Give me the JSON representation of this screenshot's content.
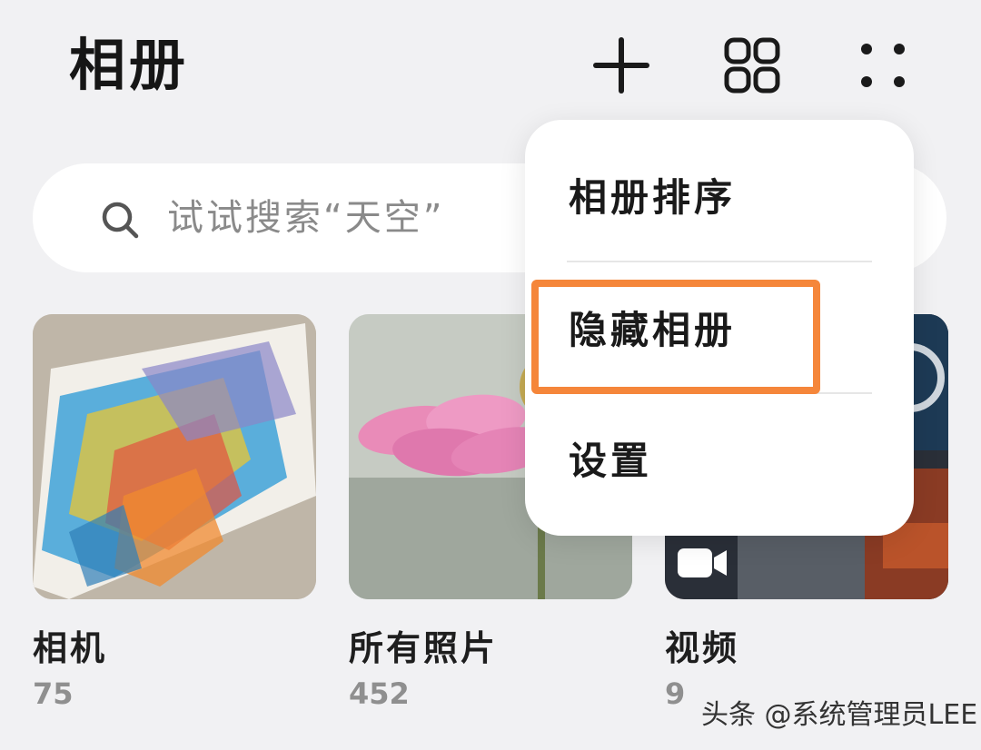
{
  "header": {
    "title": "相册",
    "icons": [
      "plus-icon",
      "grid-icon",
      "more-dots-icon"
    ]
  },
  "search": {
    "placeholder": "试试搜索“天空”"
  },
  "albums": [
    {
      "name": "相机",
      "count": "75"
    },
    {
      "name": "所有照片",
      "count": "452"
    },
    {
      "name": "视频",
      "count": "9"
    }
  ],
  "menu": {
    "items": [
      {
        "label": "相册排序"
      },
      {
        "label": "隐藏相册"
      },
      {
        "label": "设置"
      }
    ],
    "highlighted_item": "隐藏相册"
  },
  "watermark": "头条 @系统管理员LEE",
  "colors": {
    "background": "#f1f1f3",
    "highlight": "#f5863a"
  }
}
